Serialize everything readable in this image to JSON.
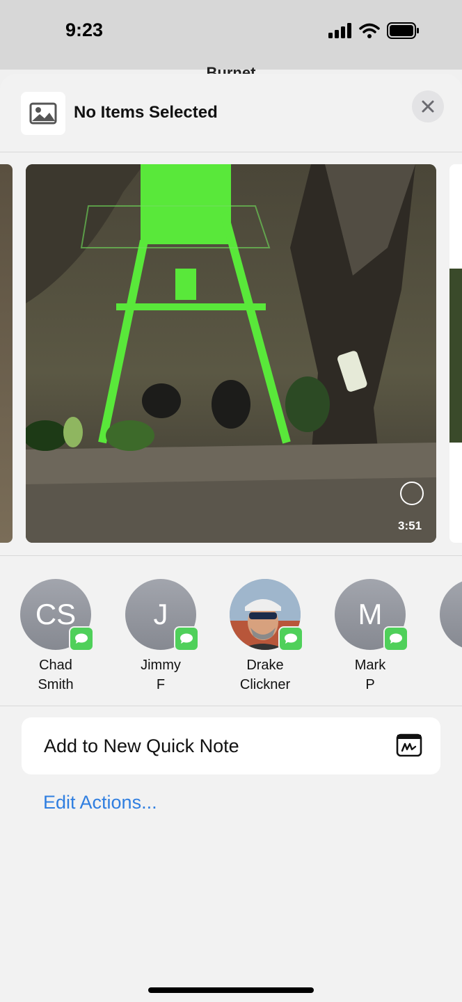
{
  "status_bar": {
    "time": "9:23"
  },
  "background": {
    "title": "Burnet"
  },
  "sheet": {
    "header": {
      "title": "No Items Selected",
      "thumbnail_icon": "photo-icon",
      "close_icon": "close-icon"
    },
    "media": {
      "duration": "3:51"
    },
    "people": [
      {
        "name_line1": "Chad",
        "name_line2": "Smith",
        "initials": "CS",
        "badge_icon": "messages-icon"
      },
      {
        "name_line1": "Jimmy",
        "name_line2": "F",
        "initials": "J",
        "badge_icon": "messages-icon"
      },
      {
        "name_line1": "Drake",
        "name_line2": "Clickner",
        "initials": "",
        "badge_icon": "messages-icon"
      },
      {
        "name_line1": "Mark",
        "name_line2": "P",
        "initials": "M",
        "badge_icon": "messages-icon"
      }
    ],
    "actions": [
      {
        "label": "Add to New Quick Note",
        "icon": "quick-note-icon"
      }
    ],
    "edit_actions_label": "Edit Actions..."
  },
  "colors": {
    "link": "#2f7ee0",
    "messages_badge": "#4fd05a",
    "avatar": "#9a9da5"
  }
}
